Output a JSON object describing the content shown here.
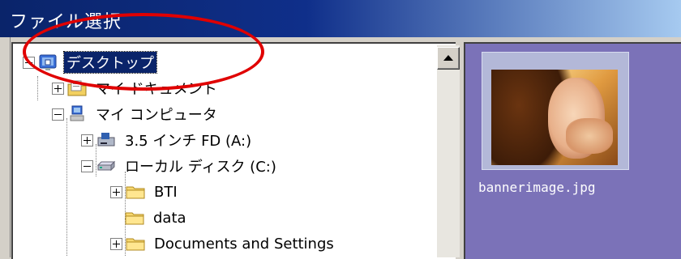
{
  "window": {
    "title": "ファイル選択"
  },
  "tree": {
    "items": [
      {
        "label": "デスクトップ",
        "icon": "desktop-icon",
        "expander": "minus",
        "selected": true
      },
      {
        "label": "マイ ドキュメント",
        "icon": "my-documents-icon",
        "expander": "plus"
      },
      {
        "label": "マイ コンピュータ",
        "icon": "my-computer-icon",
        "expander": "minus"
      },
      {
        "label": "3.5 インチ FD (A:)",
        "icon": "floppy-drive-icon",
        "expander": "plus"
      },
      {
        "label": "ローカル ディスク (C:)",
        "icon": "hard-disk-icon",
        "expander": "minus"
      },
      {
        "label": "BTI",
        "icon": "folder-icon",
        "expander": "plus"
      },
      {
        "label": "data",
        "icon": "folder-icon",
        "expander": "none"
      },
      {
        "label": "Documents and Settings",
        "icon": "folder-icon",
        "expander": "plus"
      }
    ]
  },
  "files": [
    {
      "name": "bannerimage.jpg",
      "icon": "image-thumbnail"
    }
  ],
  "colors": {
    "title_bar": "#0a246a",
    "selection": "#0a246a",
    "annotation_oval": "#e00000",
    "file_panel_bg": "#7b72b8"
  }
}
